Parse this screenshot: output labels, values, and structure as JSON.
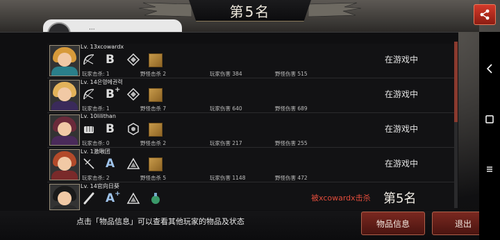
{
  "title": "第5名",
  "hidden_tab_text": "···",
  "players": [
    {
      "level": "Lv. 13xcowardx",
      "grade": "B",
      "grade_plus": "",
      "weapon_icon": "bow-icon",
      "player_kills_label": "玩家击杀:",
      "player_kills": "1",
      "monster_kills_label": "野怪击杀",
      "monster_kills": "2",
      "player_damage_label": "玩家伤害",
      "player_damage": "384",
      "monster_damage_label": "野怪伤害",
      "monster_damage": "515",
      "status": "在游戏中"
    },
    {
      "level": "Lv. 14은영에권력",
      "grade": "B",
      "grade_plus": "+",
      "weapon_icon": "bow-icon",
      "player_kills_label": "玩家击杀:",
      "player_kills": "1",
      "monster_kills_label": "野怪击杀",
      "monster_kills": "7",
      "player_damage_label": "玩家伤害",
      "player_damage": "640",
      "monster_damage_label": "野怪伤害",
      "monster_damage": "689",
      "status": "在游戏中"
    },
    {
      "level": "Lv. 10lilithan",
      "grade": "B",
      "grade_plus": "",
      "weapon_icon": "glove-icon",
      "player_kills_label": "玩家击杀:",
      "player_kills": "0",
      "monster_kills_label": "野怪击杀",
      "monster_kills": "2",
      "player_damage_label": "玩家伤害",
      "player_damage": "217",
      "monster_damage_label": "野怪伤害",
      "monster_damage": "255",
      "status": "在游戏中"
    },
    {
      "level": "Lv. 1激啾团",
      "grade": "A",
      "grade_plus": "",
      "weapon_icon": "spear-icon",
      "player_kills_label": "玩家击杀:",
      "player_kills": "2",
      "monster_kills_label": "野怪击杀",
      "monster_kills": "5",
      "player_damage_label": "玩家伤害",
      "player_damage": "1148",
      "monster_damage_label": "野怪伤害",
      "monster_damage": "472",
      "status": "在游戏中"
    },
    {
      "level": "Lv. 14官向日葵",
      "grade": "A",
      "grade_plus": "+",
      "weapon_icon": "bat-icon",
      "killed_by": "被xcowardx击杀",
      "rank": "第5名"
    }
  ],
  "footer": {
    "hint": "点击「物品信息」可以查看其他玩家的物品及状态",
    "info_button": "物品信息",
    "exit_button": "退出"
  },
  "colors": {
    "accent_red": "#8c1c12",
    "killed_text": "#e24c3b",
    "grade_a": "#9fc3ea"
  }
}
